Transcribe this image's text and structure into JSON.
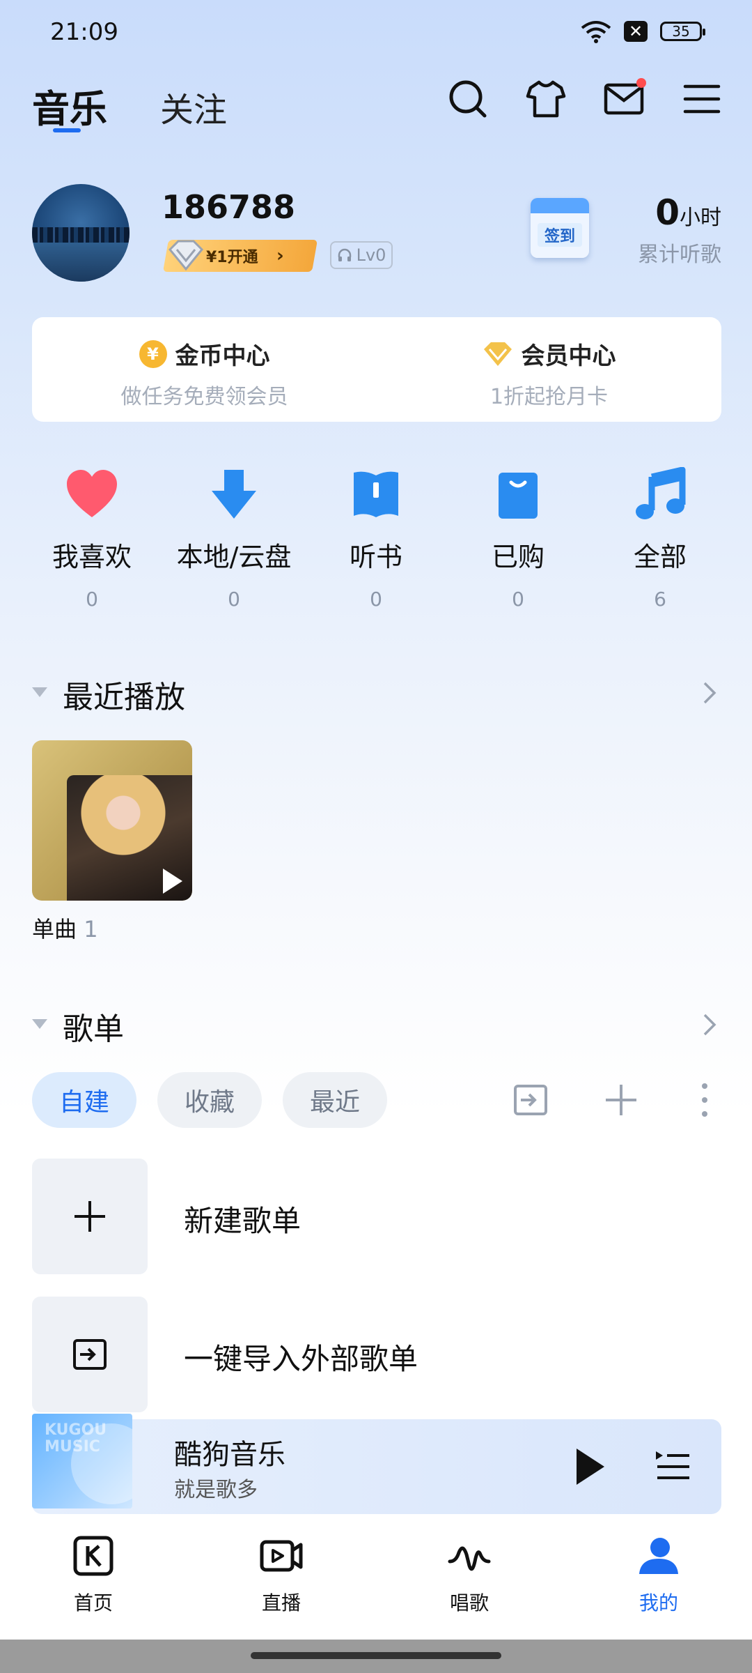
{
  "status_bar": {
    "time": "21:09",
    "battery": "35"
  },
  "top_nav": {
    "tabs": [
      "音乐",
      "关注"
    ],
    "active_tab": 0
  },
  "profile": {
    "username": "186788",
    "vip_cta": "¥1开通",
    "level": "Lv0",
    "signin_label": "签到",
    "listen_hours_value": "0",
    "listen_hours_unit": "小时",
    "listen_label": "累计听歌"
  },
  "card": {
    "coin": {
      "icon_text": "¥",
      "title": "金币中心",
      "subtitle": "做任务免费领会员"
    },
    "vip": {
      "title": "会员中心",
      "subtitle": "1折起抢月卡"
    }
  },
  "quick_entries": [
    {
      "label": "我喜欢",
      "count": "0",
      "icon": "heart-icon"
    },
    {
      "label": "本地/云盘",
      "count": "0",
      "icon": "download-icon"
    },
    {
      "label": "听书",
      "count": "0",
      "icon": "book-icon"
    },
    {
      "label": "已购",
      "count": "0",
      "icon": "bag-icon"
    },
    {
      "label": "全部",
      "count": "6",
      "icon": "music-note-icon"
    }
  ],
  "recent": {
    "title": "最近播放",
    "item_label": "单曲",
    "item_count": "1"
  },
  "playlists": {
    "title": "歌单",
    "chips": [
      "自建",
      "收藏",
      "最近"
    ],
    "rows": [
      {
        "label": "新建歌单",
        "icon": "plus-icon"
      },
      {
        "label": "一键导入外部歌单",
        "icon": "import-icon"
      }
    ]
  },
  "mini_player": {
    "cover_text": "KUGOU MUSIC",
    "title": "酷狗音乐",
    "subtitle": "就是歌多"
  },
  "bottom_nav": [
    {
      "label": "首页",
      "icon": "home-k-icon"
    },
    {
      "label": "直播",
      "icon": "live-video-icon"
    },
    {
      "label": "唱歌",
      "icon": "sing-wave-icon"
    },
    {
      "label": "我的",
      "icon": "profile-icon"
    }
  ],
  "colors": {
    "accent": "#1e6cf0",
    "heart": "#ff5a6e",
    "entry_blue": "#2a8cf0",
    "vip_gold": "#f4a73b"
  }
}
